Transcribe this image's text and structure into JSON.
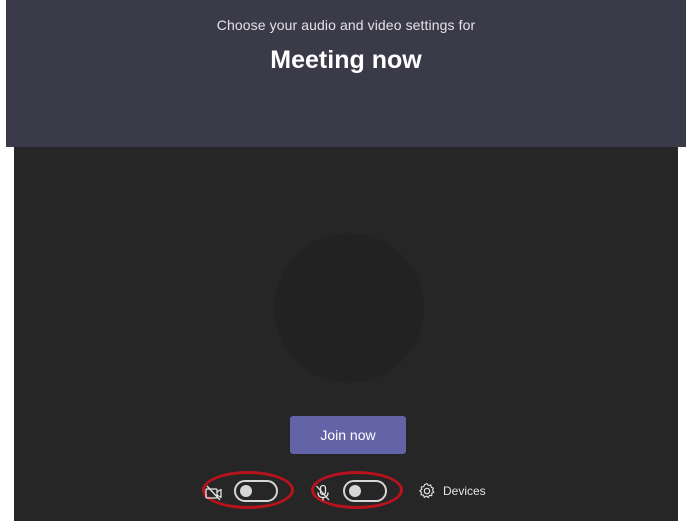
{
  "header": {
    "subtitle": "Choose your audio and video settings for",
    "title": "Meeting now"
  },
  "preview": {
    "join_label": "Join now"
  },
  "controls": {
    "camera": {
      "icon": "camera-off-icon",
      "toggle_on": false
    },
    "microphone": {
      "icon": "microphone-off-icon",
      "toggle_on": false
    },
    "devices": {
      "icon": "gear-icon",
      "label": "Devices"
    }
  },
  "colors": {
    "header_bg": "#3b3a48",
    "preview_bg": "#262626",
    "accent": "#6264a7",
    "highlight": "#b8121d"
  }
}
